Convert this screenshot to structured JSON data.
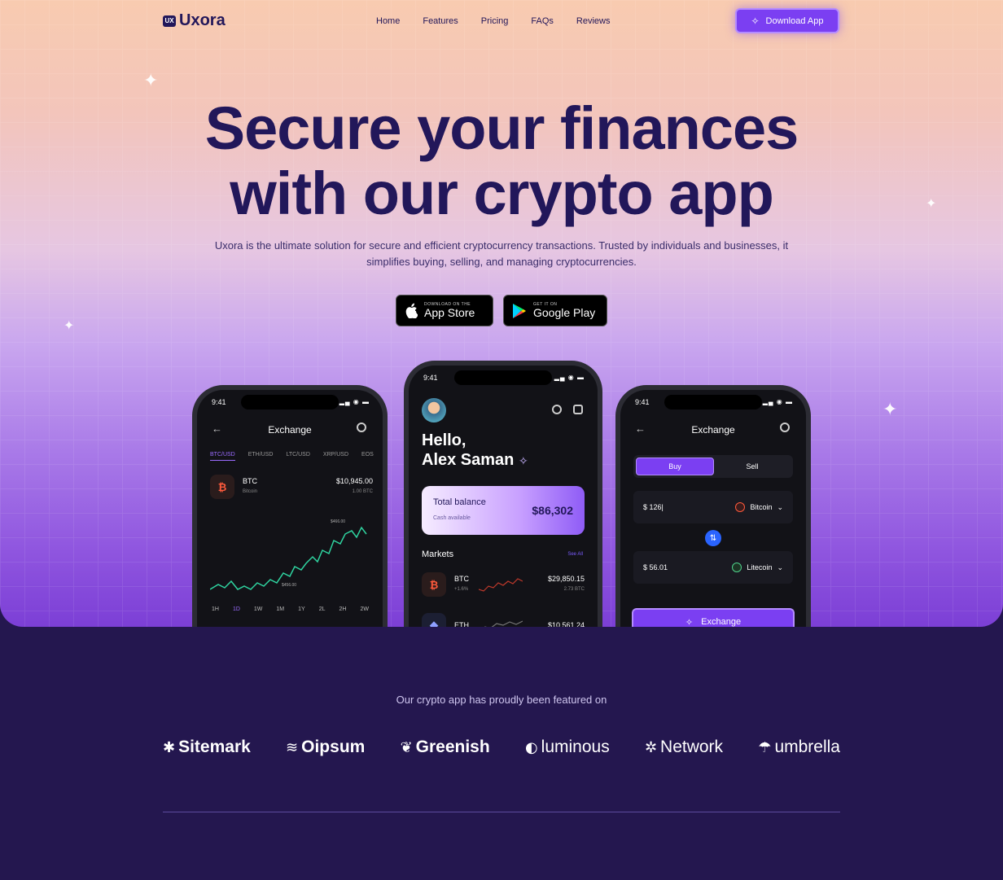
{
  "brand": {
    "name": "Uxora",
    "mark": "UX"
  },
  "nav": {
    "home": "Home",
    "features": "Features",
    "pricing": "Pricing",
    "faqs": "FAQs",
    "reviews": "Reviews"
  },
  "cta": {
    "download": "Download App"
  },
  "hero": {
    "title_line1": "Secure your finances",
    "title_line2": "with our crypto app",
    "subtitle": "Uxora is the ultimate solution for secure and efficient cryptocurrency transactions. Trusted by individuals and businesses, it simplifies buying, selling, and managing cryptocurrencies."
  },
  "stores": {
    "apple_small": "DOWNLOAD ON THE",
    "apple_big": "App Store",
    "google_small": "GET IT ON",
    "google_big": "Google Play"
  },
  "phone_left": {
    "time": "9:41",
    "title": "Exchange",
    "pairs": [
      "BTC/USD",
      "ETH/USD",
      "LTC/USD",
      "XRP/USD",
      "EOS"
    ],
    "coin": {
      "symbol": "BTC",
      "name": "Bitcoin",
      "price": "$10,945.00",
      "amount": "1.00 BTC"
    },
    "peak_label": "$466.00",
    "low_label": "$456.00",
    "timeframes": [
      "1H",
      "1D",
      "1W",
      "1M",
      "1Y",
      "2L",
      "2H",
      "2W"
    ]
  },
  "phone_mid": {
    "time": "9:41",
    "greeting": "Hello,",
    "user": "Alex Saman",
    "balance_label": "Total balance",
    "balance_sub": "Cash available",
    "balance": "$86,302",
    "markets": "Markets",
    "see_all": "See All",
    "rows": [
      {
        "symbol": "BTC",
        "change": "+1.6%",
        "price": "$29,850.15",
        "amount": "2.73 BTC"
      },
      {
        "symbol": "ETH",
        "change": "",
        "price": "$10,561.24",
        "amount": ""
      }
    ]
  },
  "phone_right": {
    "time": "9:41",
    "title": "Exchange",
    "buy": "Buy",
    "sell": "Sell",
    "from_amount": "$ 126|",
    "from_coin": "Bitcoin",
    "to_amount": "$ 56.01",
    "to_coin": "Litecoin",
    "exchange_button": "Exchange"
  },
  "featured": {
    "caption": "Our crypto app has proudly been featured on",
    "logos": [
      "Sitemark",
      "Oipsum",
      "Greenish",
      "luminous",
      "Network",
      "umbrella"
    ]
  },
  "colors": {
    "accent": "#7b3ff2",
    "navy": "#22175a",
    "dark_bg": "#24174f"
  },
  "icons": [
    "sparkle-icon",
    "apple-icon",
    "google-play-icon",
    "search-icon",
    "back-arrow-icon",
    "swap-icon"
  ]
}
